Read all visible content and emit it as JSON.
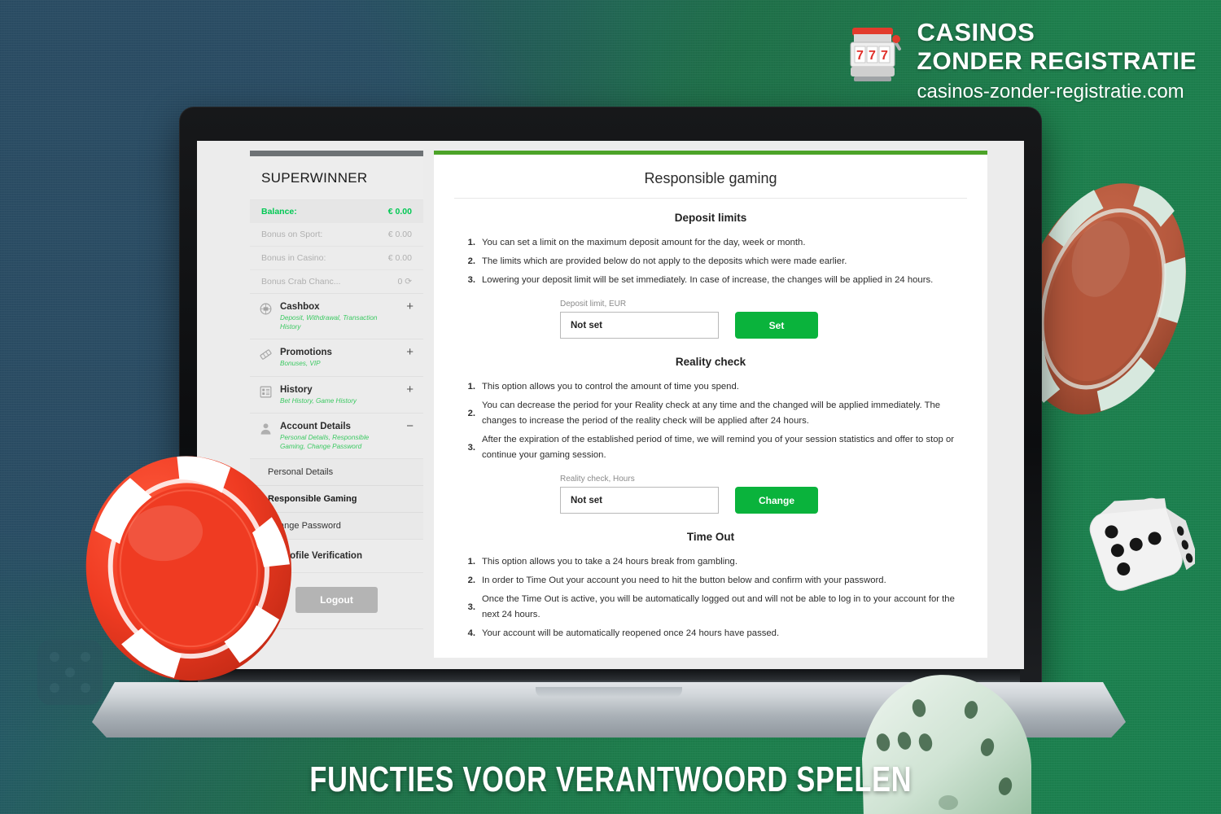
{
  "brand": {
    "line1": "CASINOS",
    "line2": "ZONDER REGISTRATIE",
    "url": "casinos-zonder-registratie.com",
    "icon": "slot-machine-777-icon"
  },
  "banner": {
    "text": "FUNCTIES VOOR VERANTWOORD SPELEN"
  },
  "sidebar": {
    "site_title": "SUPERWINNER",
    "balances": [
      {
        "label": "Balance:",
        "value": "€ 0.00",
        "primary": true
      },
      {
        "label": "Bonus on Sport:",
        "value": "€ 0.00",
        "primary": false
      },
      {
        "label": "Bonus in Casino:",
        "value": "€ 0.00",
        "primary": false
      },
      {
        "label": "Bonus Crab Chanc...",
        "value": "0 ⟳",
        "primary": false
      }
    ],
    "nav": [
      {
        "title": "Cashbox",
        "sub": "Deposit, Withdrawal, Transaction History",
        "toggle": "+",
        "icon": "cashbox-icon"
      },
      {
        "title": "Promotions",
        "sub": "Bonuses, VIP",
        "toggle": "+",
        "icon": "ticket-icon"
      },
      {
        "title": "History",
        "sub": "Bet History, Game History",
        "toggle": "+",
        "icon": "list-icon"
      },
      {
        "title": "Account Details",
        "sub": "Personal Details, Responsible Gaming, Change Password",
        "toggle": "−",
        "icon": "user-icon"
      }
    ],
    "sub_items": [
      {
        "label": "Personal Details",
        "active": false
      },
      {
        "label": "Responsible Gaming",
        "active": true
      },
      {
        "label": "Change Password",
        "active": false
      }
    ],
    "profile_verification": "Profile Verification",
    "logout": "Logout"
  },
  "main": {
    "title": "Responsible gaming",
    "sections": [
      {
        "heading": "Deposit limits",
        "items": [
          "You can set a limit on the maximum deposit amount for the day, week or month.",
          "The limits which are provided below do not apply to the deposits which were made earlier.",
          "Lowering your deposit limit will be set immediately. In case of increase, the changes will be applied in 24 hours."
        ],
        "field_label": "Deposit limit, EUR",
        "field_value": "Not set",
        "button": "Set"
      },
      {
        "heading": "Reality check",
        "items": [
          "This option allows you to control the amount of time you spend.",
          "You can decrease the period for your Reality check at any time and the changed will be applied immediately. The changes to increase the period of the reality check will be applied after 24 hours.",
          "After the expiration of the established period of time, we will remind you of your session statistics and offer to stop or continue your gaming session."
        ],
        "field_label": "Reality check, Hours",
        "field_value": "Not set",
        "button": "Change"
      },
      {
        "heading": "Time Out",
        "items": [
          "This option allows you to take a 24 hours break from gambling.",
          "In order to Time Out your account you need to hit the button below and confirm with your password.",
          "Once the Time Out is active, you will be automatically logged out and will not be able to log in to your account for the next 24 hours.",
          "Your account will be automatically reopened once 24 hours have passed."
        ],
        "field_label": "",
        "field_value": "",
        "button": ""
      }
    ]
  },
  "colors": {
    "brand_green": "#1e7f4d",
    "background_blue": "#2b4d64",
    "accent_green": "#0ab33c",
    "bar_green": "#4ca328",
    "balance_green": "#00c853",
    "sub_green": "#3cc962",
    "logout_grey": "#b4b4b4"
  }
}
